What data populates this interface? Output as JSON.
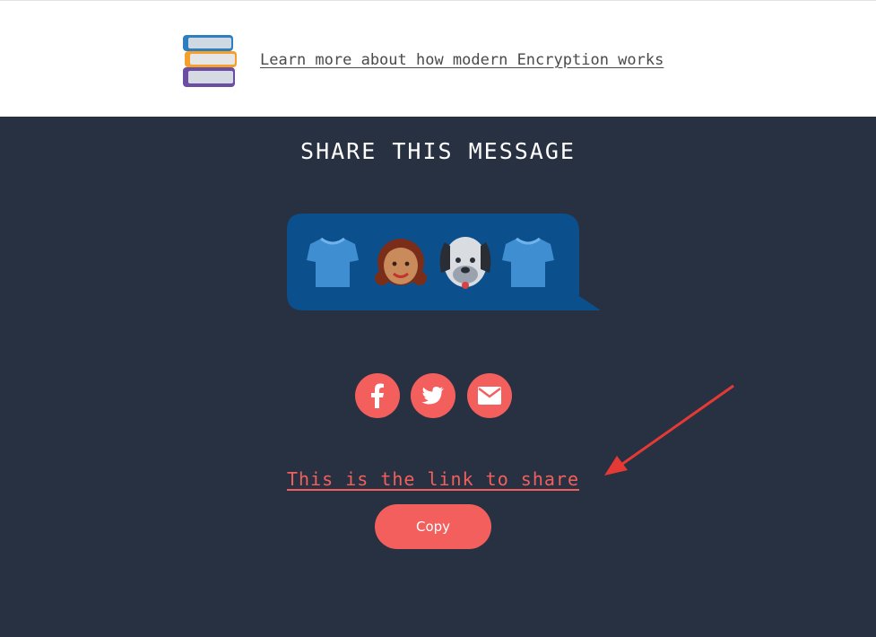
{
  "header": {
    "learn_link": "Learn more about how modern Encryption works",
    "books_icon": "books-icon"
  },
  "share": {
    "title": "SHARE THIS MESSAGE",
    "message_emojis": [
      "t-shirt-icon",
      "girl-icon",
      "dog-face-icon",
      "t-shirt-icon"
    ],
    "link_text": "This is the link to share",
    "copy_label": "Copy"
  },
  "social_buttons": [
    "facebook-icon",
    "twitter-icon",
    "email-icon"
  ],
  "colors": {
    "background": "#283142",
    "accent": "#f25f5c",
    "bubble": "#0b4f8c"
  }
}
